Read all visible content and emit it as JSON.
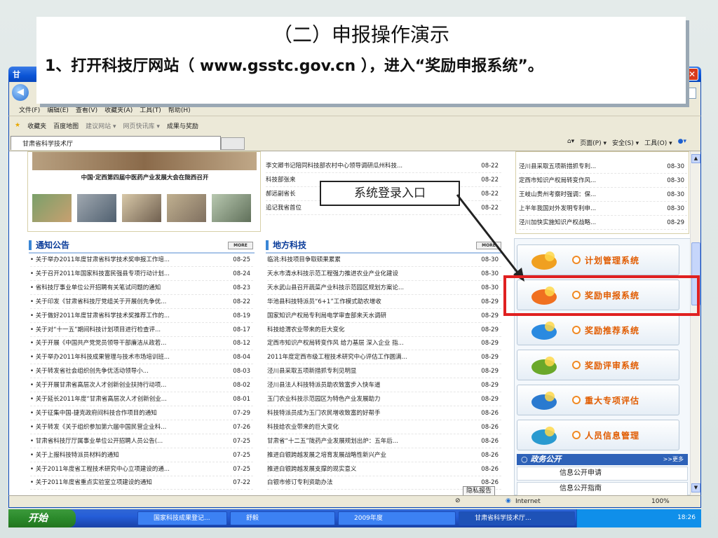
{
  "slide": {
    "title": "（二）申报操作演示",
    "body": "1、打开科技厅网站（ www.gsstc.gov.cn ），进入“奖励申报系统”。",
    "callout": "系统登录入口"
  },
  "browser": {
    "window_title": "甘",
    "help_label": "▾",
    "menu": [
      "文件(F)",
      "编辑(E)",
      "查看(V)",
      "收藏夹(A)",
      "工具(T)",
      "帮助(H)"
    ],
    "favorites": [
      "收藏夹",
      "百度地图",
      "建议网站 ▾",
      "网页快讯库 ▾",
      "成果与奖励"
    ],
    "tab_label": "甘肃省科学技术厅",
    "tools": [
      "页面(P) ▾",
      "安全(S) ▾",
      "工具(O) ▾"
    ],
    "status_zone": "Internet",
    "zoom": "100%",
    "privacy_report": "隐私报告"
  },
  "taskbar": {
    "start_label": "开始",
    "windows": [
      "国家科技成果登记...",
      "舒毅",
      "2009年度",
      "甘肃省科学技术厅..."
    ],
    "clock": "18:26"
  },
  "page": {
    "photo_caption": "中国·定西第四届中医药产业发展大会在陇西召开",
    "top_news": [
      {
        "t": "李文卿书记陪同科技部农村中心领导调研瓜州科技...",
        "d": "08-22"
      },
      {
        "t": "科技部张来",
        "d": "08-22"
      },
      {
        "t": "郝远副省长",
        "d": "08-22"
      },
      {
        "t": "追记我省首位",
        "d": "08-22"
      }
    ],
    "right_news": [
      {
        "t": "泾川县采取五项新措抓专利...",
        "d": "08-30"
      },
      {
        "t": "定西市知识产权局转变作风...",
        "d": "08-30"
      },
      {
        "t": "王岐山贵州考察时强调：保...",
        "d": "08-30"
      },
      {
        "t": "上半年我国对外发明专利申...",
        "d": "08-30"
      },
      {
        "t": "泾川加快实施知识产权战略...",
        "d": "08-29"
      }
    ],
    "notice_title": "通知公告",
    "local_title": "地方科技",
    "more_label": "MORE",
    "notices": [
      {
        "t": "• 关于举办2011年度甘肃省科学技术奖申报工作培...",
        "d": "08-25"
      },
      {
        "t": "• 关于召开2011年国家科技富民强县专项行动计划...",
        "d": "08-24"
      },
      {
        "t": "• 省科技厅事业单位公开招聘有关笔试问题的通知",
        "d": "08-23"
      },
      {
        "t": "• 关于印发《甘肃省科技厅党组关于开展创先争优...",
        "d": "08-22"
      },
      {
        "t": "• 关于做好2011年度甘肃省科学技术奖推荐工作的...",
        "d": "08-19"
      },
      {
        "t": "• 关于对“十一五”期间科技计划项目进行检查评...",
        "d": "08-17"
      },
      {
        "t": "• 关于开展《中国共产党党员领导干部廉洁从政若...",
        "d": "08-12"
      },
      {
        "t": "• 关于举办2011年科技成果管理与技术市场培训班...",
        "d": "08-04"
      },
      {
        "t": "• 关于转发省社会组织创先争优活动领导小...",
        "d": "08-03"
      },
      {
        "t": "• 关于开展甘肃省高层次人才创新创业扶持行动项...",
        "d": "08-02"
      },
      {
        "t": "• 关于延长2011年度“甘肃省高层次人才创新创业...",
        "d": "08-01"
      },
      {
        "t": "• 关于征集中国-捷克政府间科技合作项目的通知",
        "d": "07-29"
      },
      {
        "t": "• 关于转发《关于组织参加第六届中国民营企业科...",
        "d": "07-26"
      },
      {
        "t": "• 甘肃省科技厅厅属事业单位公开招聘人员公告(...",
        "d": "07-25"
      },
      {
        "t": "• 关于上报科技特派员材料的通知",
        "d": "07-25"
      },
      {
        "t": "• 关于2011年度省工程技术研究中心立项建设的通...",
        "d": "07-25"
      },
      {
        "t": "• 关于2011年度省重点实验室立项建设的通知",
        "d": "07-22"
      }
    ],
    "local_news": [
      {
        "t": "临洮:科技项目争取硕果累累",
        "d": "08-30"
      },
      {
        "t": "天水市清水科技示范工程强力推进农业产业化建设",
        "d": "08-30"
      },
      {
        "t": "天水武山县召开蔬菜产业科技示范园区规划方案论...",
        "d": "08-30"
      },
      {
        "t": "华池县科技特派员“6+1”工作模式助农增收",
        "d": "08-29"
      },
      {
        "t": "国家知识产权局专利局电学审查部来天水调研",
        "d": "08-29"
      },
      {
        "t": "科技给渭农业带来的巨大变化",
        "d": "08-29"
      },
      {
        "t": "定西市知识产权局转变作风 给力基层 深入企业 指...",
        "d": "08-29"
      },
      {
        "t": "2011年度定西市级工程技术研究中心评估工作圆满...",
        "d": "08-29"
      },
      {
        "t": "泾川县采取五项新措抓专利见明显",
        "d": "08-29"
      },
      {
        "t": "泾川县法人科技特派员助农致富步入快车道",
        "d": "08-29"
      },
      {
        "t": "玉门农业科技示范园区为特色产业发展助力",
        "d": "08-29"
      },
      {
        "t": "科技特派员成为玉门农民增收致富的好帮手",
        "d": "08-26"
      },
      {
        "t": "科技给农业带来的巨大变化",
        "d": "08-26"
      },
      {
        "t": "甘肃省“十二五”陇药产业发展规划出炉：五年后...",
        "d": "08-26"
      },
      {
        "t": "推进白银跨越发展之培育发展战略性新兴产业",
        "d": "08-26"
      },
      {
        "t": "推进白银跨越发展支撑的现实意义",
        "d": "08-26"
      },
      {
        "t": "白银市修订专利资助办法",
        "d": "08-26"
      }
    ],
    "systems": [
      {
        "label": "计划管理系统",
        "icon": "pie-chart-icon"
      },
      {
        "label": "奖励申报系统",
        "icon": "pencil-trophy-icon"
      },
      {
        "label": "奖励推荐系统",
        "icon": "ball-icon"
      },
      {
        "label": "奖励评审系统",
        "icon": "people-icon"
      },
      {
        "label": "重大专项评估",
        "icon": "chart-icon"
      },
      {
        "label": "人员信息管理",
        "icon": "user-info-icon"
      }
    ],
    "gov_title": "政务公开",
    "gov_more": ">>更多",
    "gov_items": [
      "信息公开申请",
      "信息公开指南"
    ]
  }
}
